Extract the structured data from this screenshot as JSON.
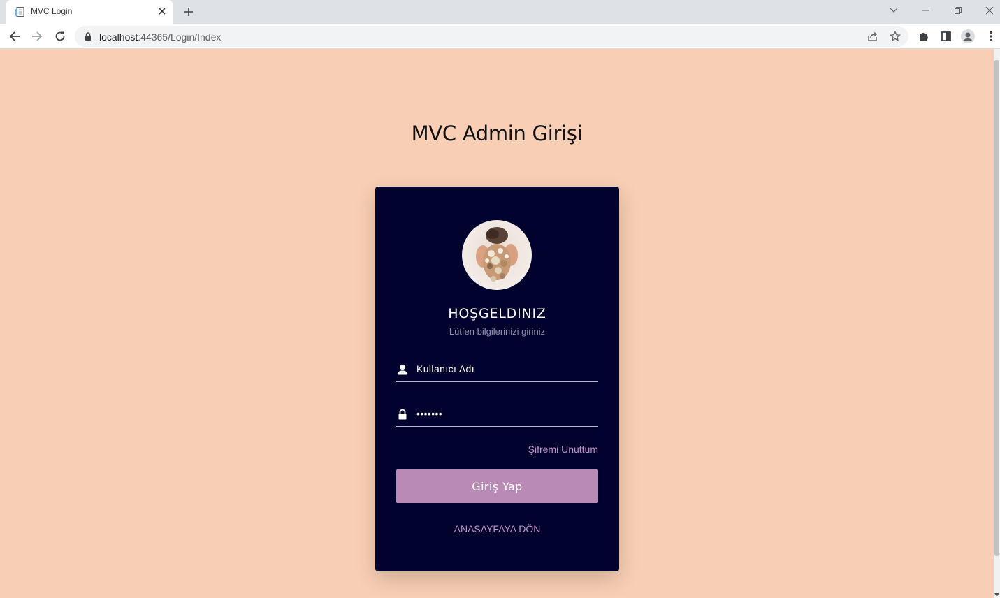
{
  "browser": {
    "tab_title": "MVC Login",
    "url_host": "localhost",
    "url_path": ":44365/Login/Index"
  },
  "page": {
    "title": "MVC Admin Girişi"
  },
  "login_card": {
    "welcome": "HOŞGELDINIZ",
    "subtitle": "Lütfen bilgilerinizi giriniz",
    "username_placeholder": "Kullanıcı Adı",
    "password_value": "•••••••",
    "forgot_password": "Şifremi Unuttum",
    "submit_label": "Giriş Yap",
    "home_link": "ANASAYFAYA DÖN"
  },
  "colors": {
    "page_background": "#f8cfb4",
    "card_background": "#02022e",
    "accent": "#b98ab5",
    "link": "#c291c7"
  },
  "icons": {
    "username": "user-icon",
    "password": "lock-icon"
  }
}
